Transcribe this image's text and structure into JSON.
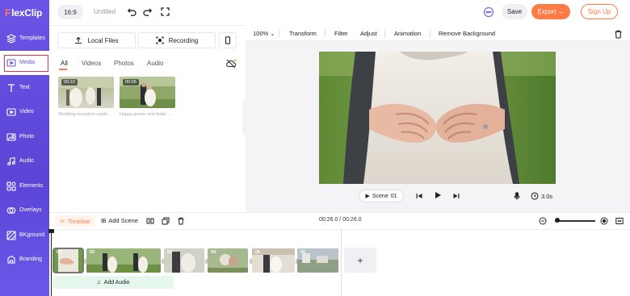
{
  "brand": {
    "logo_text": "FlexClip",
    "logo_first": "F",
    "logo_rest": "lexClip",
    "accent": "#ff7a45",
    "sidebar_color": "#6a55e6"
  },
  "sidebar": {
    "items": [
      {
        "label": "Templates",
        "icon": "templates-icon"
      },
      {
        "label": "Media",
        "icon": "media-icon",
        "active": true
      },
      {
        "label": "Text",
        "icon": "text-icon"
      },
      {
        "label": "Video",
        "icon": "video-icon"
      },
      {
        "label": "Photo",
        "icon": "photo-icon"
      },
      {
        "label": "Audio",
        "icon": "audio-icon"
      },
      {
        "label": "Elements",
        "icon": "elements-icon"
      },
      {
        "label": "Overlays",
        "icon": "overlays-icon"
      },
      {
        "label": "BKground",
        "icon": "background-icon"
      },
      {
        "label": "Branding",
        "icon": "branding-icon"
      }
    ]
  },
  "topbar": {
    "ratio": "16:9",
    "title": "Untitled",
    "save_label": "Save",
    "export_label": "Export",
    "signup_label": "Sign Up"
  },
  "media_panel": {
    "local_files_label": "Local Files",
    "recording_label": "Recording",
    "tabs": [
      "All",
      "Videos",
      "Photos",
      "Audio"
    ],
    "items": [
      {
        "duration": "00:10",
        "caption": "Wedding reception outdo..."
      },
      {
        "duration": "00:06",
        "caption": "Happy groom and bride ..."
      }
    ]
  },
  "editor": {
    "zoom": "100%",
    "toolbar": [
      "Transform",
      "Filter",
      "Adjust",
      "Animation",
      "Remove Background"
    ],
    "scene_label": "Scene",
    "scene_number": "01",
    "scene_duration": "3.0s"
  },
  "timeline": {
    "label": "Timeline",
    "add_scene_label": "Add Scene",
    "time_display": "00:26.0 / 00:26.0",
    "add_audio_label": "Add Audio",
    "clips": [
      "01",
      "02",
      "03",
      "04",
      "05",
      "06"
    ]
  }
}
